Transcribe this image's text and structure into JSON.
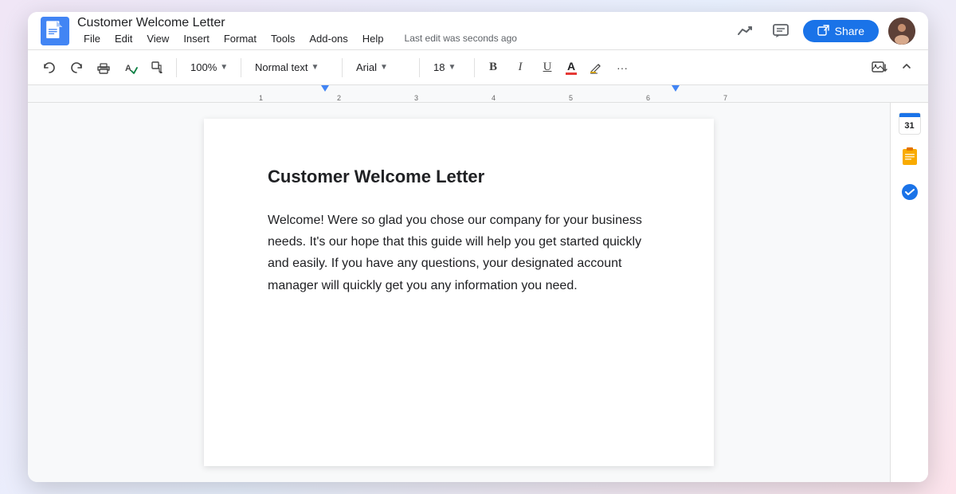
{
  "app": {
    "title": "Customer Welcome Letter",
    "doc_icon_label": "Google Docs",
    "last_edit": "Last edit was seconds ago"
  },
  "menu": {
    "items": [
      "File",
      "Edit",
      "View",
      "Insert",
      "Format",
      "Tools",
      "Add-ons",
      "Help"
    ]
  },
  "toolbar": {
    "zoom": "100%",
    "style": "Normal text",
    "font": "Arial",
    "size": "18",
    "bold": "B",
    "italic": "I",
    "underline": "U",
    "more": "···"
  },
  "share_button": {
    "label": "Share",
    "icon": "share"
  },
  "document": {
    "heading": "Customer Welcome Letter",
    "body": "Welcome! Were so glad you chose our company for your business needs. It's our hope that this guide will help you get started quickly and easily. If you have any questions, your designated account manager will quickly get you any information you need."
  },
  "right_sidebar": {
    "icons": [
      {
        "name": "calendar",
        "label": "Calendar",
        "number": "31"
      },
      {
        "name": "keep",
        "label": "Keep Notes"
      },
      {
        "name": "tasks",
        "label": "Tasks"
      }
    ]
  },
  "ruler": {
    "markers": [
      "1",
      "2",
      "3",
      "4",
      "5",
      "6",
      "7"
    ]
  }
}
